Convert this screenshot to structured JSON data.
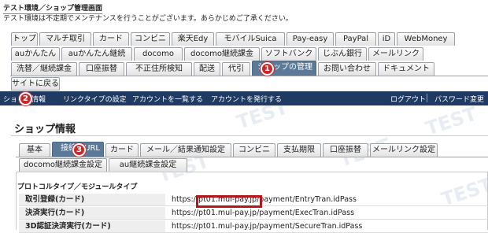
{
  "env": {
    "title": "テスト環境／ショップ管理画面",
    "notice": "テスト環境は不定期でメンテナンスを行うことがございます。あらかじめご了承ください。"
  },
  "shop_menu": {
    "row1": [
      "トップ",
      "マルチ取引",
      "カード",
      "コンビニ",
      "楽天Edy",
      "モバイルSuica",
      "Pay-easy",
      "PayPal",
      "iD",
      "WebMoney"
    ],
    "row2": [
      "auかんたん",
      "auかんたん継続",
      "docomo",
      "docomo継続課金",
      "ソフトバンク",
      "じぶん銀行",
      "メールリンク"
    ],
    "row3": [
      "洗替／継続課金",
      "口座振替",
      "不正住所検知",
      "配送",
      "代引",
      "ショップの管理",
      "お問い合わせ",
      "ドキュメント"
    ],
    "row4": [
      "サイトに戻る"
    ]
  },
  "nav": {
    "left": [
      "ショップ情報",
      "リンクタイプの設定",
      "アカウントを一覧する",
      "アカウントを発行する"
    ],
    "right": [
      "ログアウト",
      "パスワード変更"
    ]
  },
  "page": {
    "title": "ショップ情報"
  },
  "shopinfo_tabs": {
    "row1": [
      "基本",
      "接続先URL",
      "カード",
      "メール／結果通知設定",
      "コンビニ",
      "支払期限",
      "口座振替",
      "メールリンク設定"
    ],
    "row2": [
      "docomo継続課金設定",
      "au継続課金設定"
    ]
  },
  "section": {
    "title": "プロトコルタイプ／モジュールタイプ",
    "rows": [
      {
        "label": "取引登録(カード)",
        "value": "https://pt01.mul-pay.jp/payment/EntryTran.idPass"
      },
      {
        "label": "決済実行(カード)",
        "value": "https://pt01.mul-pay.jp/payment/ExecTran.idPass"
      },
      {
        "label": "3D認証決済実行(カード)",
        "value": "https://pt01.mul-pay.jp/payment/SecureTran.idPass"
      }
    ]
  },
  "highlighted_host": "pt01.mul-pay.jp",
  "watermark": "TEST",
  "callouts": [
    "1",
    "2",
    "3"
  ],
  "colors": {
    "navbar": "#1f3a63",
    "active_tab": "#5b7a9a",
    "callout": "#c8282c"
  }
}
